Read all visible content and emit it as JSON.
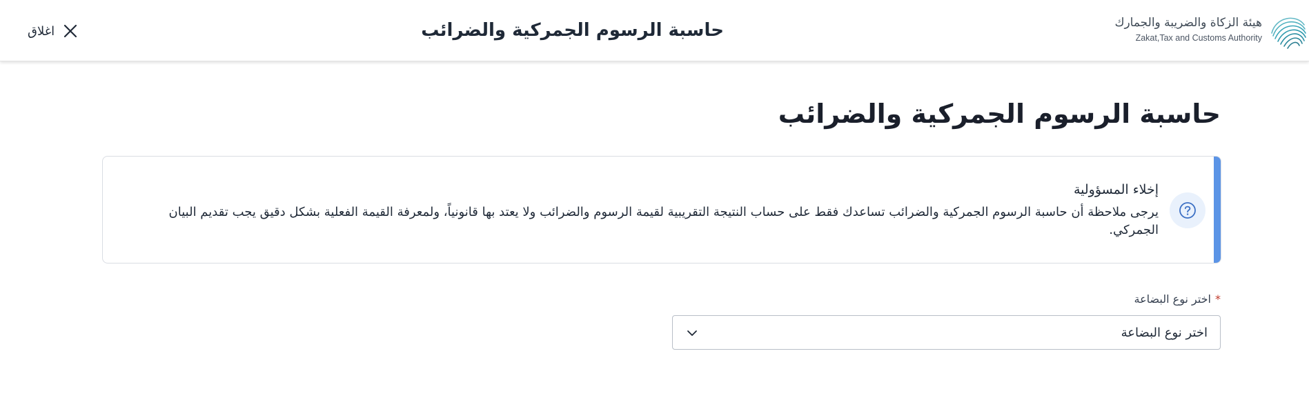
{
  "header": {
    "brand_name_ar": "هيئة الزكاة والضريبة والجمارك",
    "brand_name_en": "Zakat,Tax and Customs Authority",
    "title": "حاسبة الرسوم الجمركية والضرائب",
    "close_label": "اغلاق"
  },
  "page": {
    "title": "حاسبة الرسوم الجمركية والضرائب"
  },
  "disclaimer": {
    "title": "إخلاء المسؤولية",
    "body": "يرجى ملاحظة أن حاسبة الرسوم الجمركية والضرائب تساعدك فقط على حساب النتيجة التقريبية لقيمة الرسوم والضرائب ولا يعتد بها قانونياً، ولمعرفة القيمة الفعلية بشكل دقيق يجب تقديم البيان الجمركي."
  },
  "goods_type": {
    "label": "اختر نوع البضاعة",
    "required_mark": "*",
    "selected": "اختر نوع البضاعة"
  },
  "colors": {
    "accent": "#5b94e6",
    "brand": "#3aa6b9",
    "required": "#c0392b"
  },
  "icons": {
    "brand": "zatca-emblem-icon",
    "close": "close-icon",
    "info": "question-circle-icon",
    "dropdown": "chevron-down-icon"
  }
}
